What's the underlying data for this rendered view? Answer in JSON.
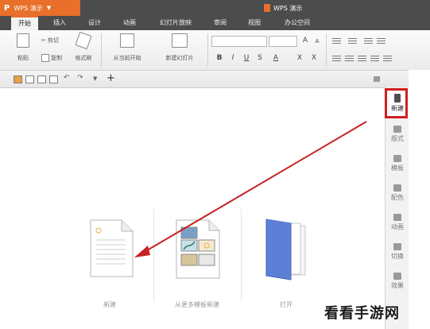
{
  "titlebar": {
    "app_button": "WPS 演示",
    "app_logo": "P",
    "window_title": "WPS 演示"
  },
  "menu": {
    "tabs": [
      "开始",
      "插入",
      "设计",
      "动画",
      "幻灯片放映",
      "审阅",
      "视图",
      "办公空间"
    ]
  },
  "ribbon": {
    "paste": "粘贴",
    "cut": "剪切",
    "copy": "复制",
    "format_painter": "格式刷",
    "from_current": "从当前开始",
    "new_slide": "新建幻灯片",
    "font_grow": "A",
    "font_shrink": "A",
    "bold": "B",
    "italic": "I",
    "underline": "U",
    "strike": "S",
    "font_color": "A",
    "superscript": "X",
    "subscript": "X"
  },
  "taskpane": {
    "items": [
      "新建",
      "版式",
      "模板",
      "配色",
      "动画",
      "切换",
      "效果"
    ]
  },
  "tiles": [
    {
      "label": "新建"
    },
    {
      "label": "从更多模板新建"
    },
    {
      "label": "打开"
    }
  ],
  "watermark": "看看手游网",
  "colors": {
    "accent": "#e8702a",
    "highlight": "#d11f1f",
    "arrow": "#c62222",
    "dark_bar": "#4c4c4c"
  },
  "icons": {
    "new_doc": "document-icon",
    "template": "template-icon",
    "open": "folder-pages-icon"
  }
}
